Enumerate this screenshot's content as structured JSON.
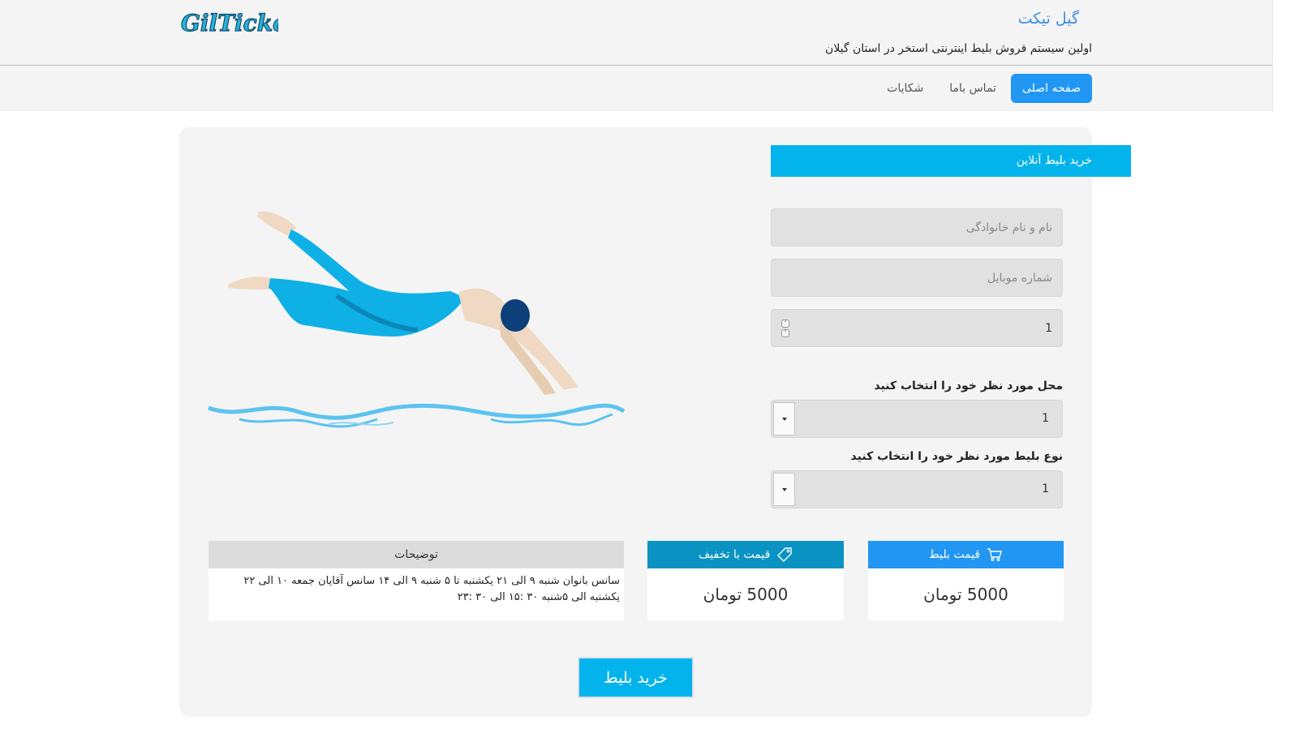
{
  "header": {
    "logo_text": "GilTicket",
    "brand_title": "گیل تیکت",
    "brand_subtitle": "اولین سیستم فروش بلیط اینترنتی استخر در استان گیلان"
  },
  "nav": {
    "items": [
      {
        "label": "صفحه اصلی",
        "active": true
      },
      {
        "label": "تماس باما",
        "active": false
      },
      {
        "label": "شکایات",
        "active": false
      }
    ]
  },
  "form": {
    "title": "خرید بلیط آنلاین",
    "name_placeholder": "نام و نام خانوادگی",
    "mobile_placeholder": "شماره موبایل",
    "quantity_value": "1",
    "location_label": "محل مورد نظر خود را انتخاب کنید",
    "location_value": "1",
    "ticket_type_label": "نوع بلیط مورد نظر خود را انتخاب کنید",
    "ticket_type_value": "1"
  },
  "price": {
    "label": "قیمت بلیط",
    "value": "5000 تومان",
    "icon": "cart-icon"
  },
  "discount": {
    "label": "قیمت با تخفیف",
    "value": "5000 تومان",
    "icon": "tag-icon"
  },
  "description": {
    "label": "توضیحات",
    "text": "سانس بانوان شنبه ۹ الی ۲۱ یکشنبه تا ۵ شنبه ۹ الی ۱۴ سانس آقایان جمعه ۱۰ الی ۲۲ یکشنبه الی ۵شنبه ۳۰ :۱۵ الی ۳۰ :۲۳"
  },
  "buy_button": "خرید بلیط",
  "colors": {
    "primary": "#2196f3",
    "accent": "#03b3ec",
    "discount": "#0a93c2",
    "card_bg": "#f4f4f4"
  }
}
